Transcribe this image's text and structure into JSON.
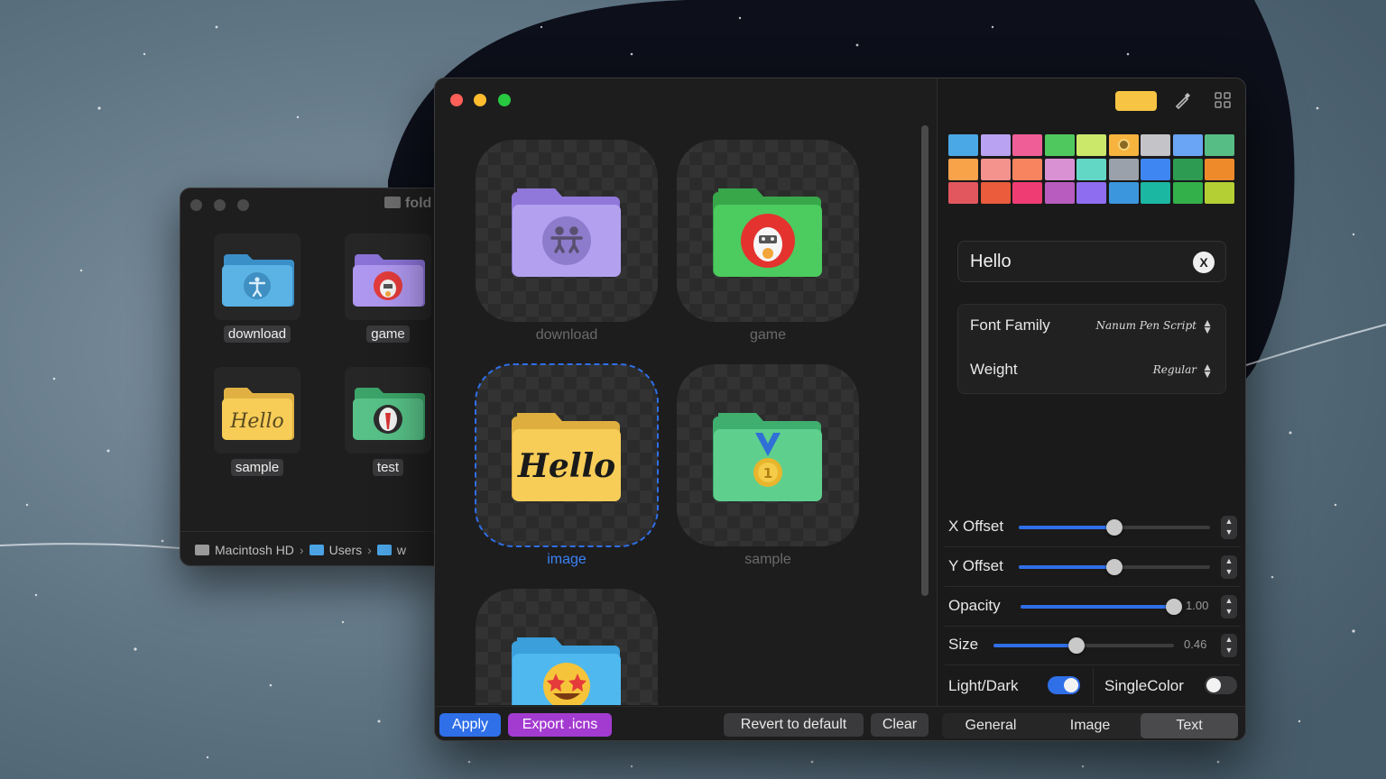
{
  "finder": {
    "title": "fold",
    "items": [
      {
        "label": "download",
        "icon": "accessibility-folder-icon"
      },
      {
        "label": "game",
        "icon": "game-character-folder-icon"
      },
      {
        "label": "sample",
        "icon": "hello-folder-icon"
      },
      {
        "label": "test",
        "icon": "character-folder-icon"
      }
    ],
    "path": [
      "Macintosh HD",
      "Users",
      "w"
    ]
  },
  "app": {
    "tiles": [
      {
        "label": "download",
        "folder_color": "#b3a1f0",
        "emblem": "accessibility-people-icon"
      },
      {
        "label": "game",
        "folder_color": "#4ccb5e",
        "emblem": "character-face-icon"
      },
      {
        "label": "image",
        "folder_color": "#f7cd58",
        "text": "Hello",
        "selected": true
      },
      {
        "label": "sample",
        "folder_color": "#5fcf8e",
        "emblem": "medal-icon"
      },
      {
        "label": "",
        "folder_color": "#4fb8ee",
        "emblem": "star-struck-emoji-icon"
      }
    ],
    "selected_color": "#f7c543",
    "palette": [
      "#4aa8e6",
      "#b9a2f2",
      "#ef5e96",
      "#4fc95e",
      "#cbe86b",
      "#f6b33d",
      "#c4c4c8",
      "#6aa5f5",
      "#56bd85",
      "#f8a24a",
      "#f4928e",
      "#f7845e",
      "#d991d4",
      "#63d7c6",
      "#9aa1aa",
      "#3e86f2",
      "#2e9b52",
      "#ef8a2b",
      "#e2575e",
      "#ea5c3b",
      "#ef3c73",
      "#b85cbf",
      "#8e6df0",
      "#3c96dd",
      "#1bb7a2",
      "#33b04a",
      "#b4cf34"
    ],
    "text_field": {
      "value": "Hello",
      "clear_label": "X"
    },
    "font_family": {
      "label": "Font Family",
      "value": "Nanum Pen Script"
    },
    "weight": {
      "label": "Weight",
      "value": "Regular"
    },
    "sliders": {
      "x_offset": {
        "label": "X Offset",
        "value": 0.5
      },
      "y_offset": {
        "label": "Y Offset",
        "value": 0.5
      },
      "opacity": {
        "label": "Opacity",
        "value": 1.0,
        "display": "1.00"
      },
      "size": {
        "label": "Size",
        "value": 0.46,
        "display": "0.46"
      }
    },
    "toggles": {
      "light_dark": {
        "label": "Light/Dark",
        "on": true
      },
      "single_color": {
        "label": "SingleColor",
        "on": false
      }
    },
    "buttons": {
      "apply": "Apply",
      "export": "Export .icns",
      "revert": "Revert to default",
      "clear": "Clear"
    },
    "tabs": [
      "General",
      "Image",
      "Text"
    ],
    "active_tab": "Text",
    "accent": "#2f6fe8",
    "export_color": "#a43bd1"
  }
}
